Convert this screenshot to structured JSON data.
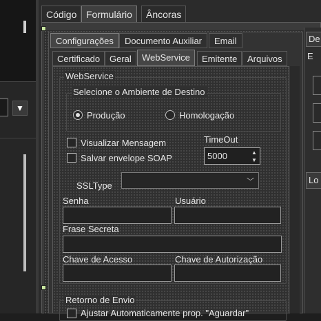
{
  "top_tabs": [
    {
      "label": "Código"
    },
    {
      "label": "Formulário"
    },
    {
      "label": "Âncoras"
    }
  ],
  "section_tabs": [
    {
      "label": "Configurações"
    },
    {
      "label": "Documento Auxiliar"
    },
    {
      "label": "Email"
    }
  ],
  "sub_tabs": [
    {
      "label": "Certificado"
    },
    {
      "label": "Geral"
    },
    {
      "label": "WebService"
    },
    {
      "label": "Emitente"
    },
    {
      "label": "Arquivos"
    }
  ],
  "right_panel": {
    "tab_label": "De",
    "tab2_label": "E",
    "section_label": "Lo"
  },
  "webservice": {
    "group_title": "WebService",
    "ambiente_title": "Selecione o Ambiente de Destino",
    "radio_producao": "Produção",
    "radio_homologacao": "Homologação",
    "chk_visualizar": "Visualizar Mensagem",
    "chk_salvar": "Salvar envelope SOAP",
    "timeout_label": "TimeOut",
    "timeout_value": "5000",
    "ssltype_label": "SSLType",
    "ssltype_value": "",
    "senha_label": "Senha",
    "usuario_label": "Usuário",
    "frase_label": "Frase Secreta",
    "chave_acesso_label": "Chave de Acesso",
    "chave_autorizacao_label": "Chave de Autorização"
  },
  "retorno": {
    "group_title": "Retorno de Envio",
    "chk_ajustar": "Ajustar Automaticamente prop. \"Aguardar\""
  }
}
